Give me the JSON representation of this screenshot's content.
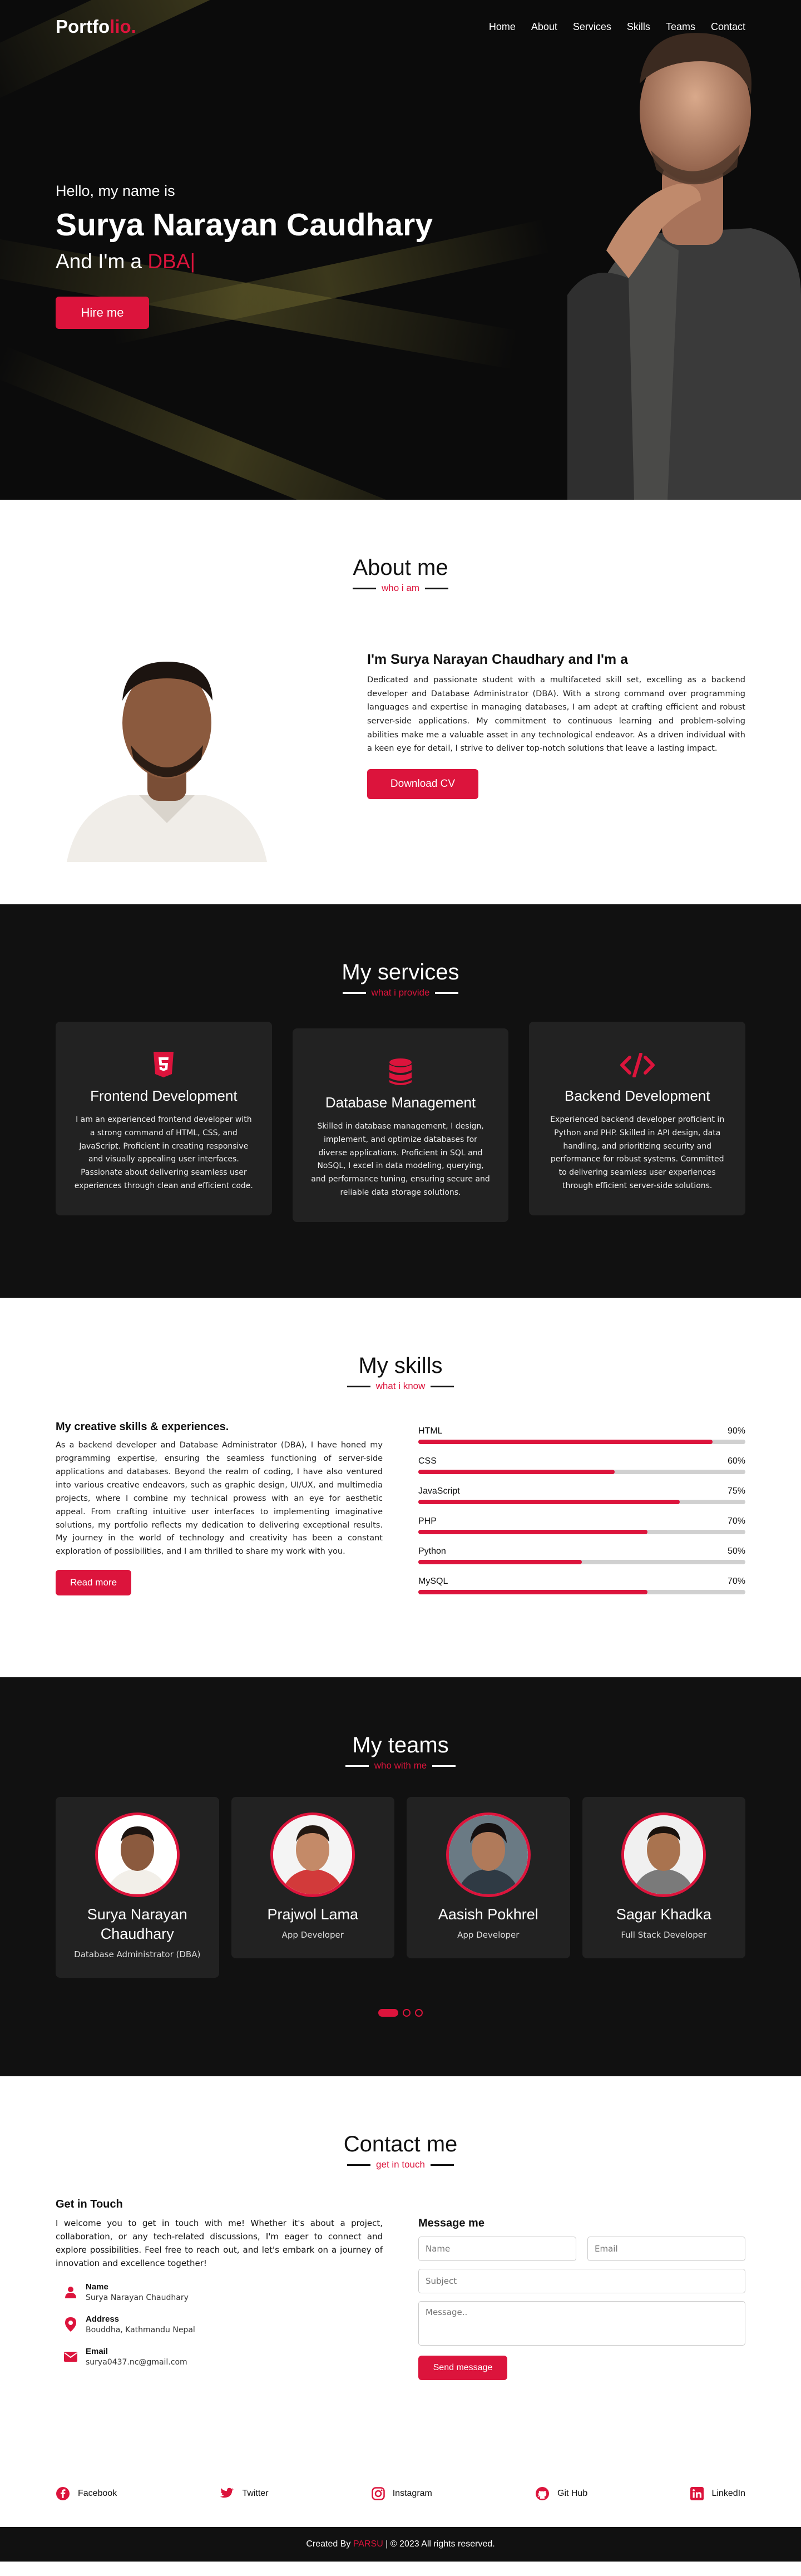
{
  "nav": {
    "logo_main": "Portfo",
    "logo_accent": "lio.",
    "items": [
      "Home",
      "About",
      "Services",
      "Skills",
      "Teams",
      "Contact"
    ]
  },
  "hero": {
    "hello": "Hello, my name is",
    "name": "Surya Narayan Caudhary",
    "role_prefix": "And I'm a",
    "role": "DBA",
    "caret": "|",
    "button": "Hire me"
  },
  "about": {
    "title": "About me",
    "subtitle": "who i am",
    "heading": "I'm Surya Narayan Chaudhary and I'm a",
    "text": "Dedicated and passionate student with a multifaceted skill set, excelling as a backend developer and Database Administrator (DBA). With a strong command over programming languages and expertise in managing databases, I am adept at crafting efficient and robust server-side applications. My commitment to continuous learning and problem-solving abilities make me a valuable asset in any technological endeavor. As a driven individual with a keen eye for detail, I strive to deliver top-notch solutions that leave a lasting impact.",
    "button": "Download CV"
  },
  "services": {
    "title": "My services",
    "subtitle": "what i provide",
    "items": [
      {
        "title": "Frontend Development",
        "icon": "html5-icon",
        "text": "I am an experienced frontend developer with a strong command of HTML, CSS, and JavaScript. Proficient in creating responsive and visually appealing user interfaces. Passionate about delivering seamless user experiences through clean and efficient code."
      },
      {
        "title": "Database Management",
        "icon": "database-icon",
        "text": "Skilled in database management, I design, implement, and optimize databases for diverse applications. Proficient in SQL and NoSQL, I excel in data modeling, querying, and performance tuning, ensuring secure and reliable data storage solutions."
      },
      {
        "title": "Backend Development",
        "icon": "code-icon",
        "text": "Experienced backend developer proficient in Python and PHP. Skilled in API design, data handling, and prioritizing security and performance for robust systems. Committed to delivering seamless user experiences through efficient server-side solutions."
      }
    ]
  },
  "skills": {
    "title": "My skills",
    "subtitle": "what i know",
    "heading": "My creative skills & experiences.",
    "text": "As a backend developer and Database Administrator (DBA), I have honed my programming expertise, ensuring the seamless functioning of server-side applications and databases. Beyond the realm of coding, I have also ventured into various creative endeavors, such as graphic design, UI/UX, and multimedia projects, where I combine my technical prowess with an eye for aesthetic appeal. From crafting intuitive user interfaces to implementing imaginative solutions, my portfolio reflects my dedication to delivering exceptional results. My journey in the world of technology and creativity has been a constant exploration of possibilities, and I am thrilled to share my work with you.",
    "button": "Read more",
    "bars": [
      {
        "name": "HTML",
        "value": "90%",
        "pct": 90
      },
      {
        "name": "CSS",
        "value": "60%",
        "pct": 60
      },
      {
        "name": "JavaScript",
        "value": "75%",
        "pct": 80
      },
      {
        "name": "PHP",
        "value": "70%",
        "pct": 70
      },
      {
        "name": "Python",
        "value": "50%",
        "pct": 50
      },
      {
        "name": "MySQL",
        "value": "70%",
        "pct": 70
      }
    ]
  },
  "teams": {
    "title": "My teams",
    "subtitle": "who with me",
    "members": [
      {
        "name": "Surya Narayan Chaudhary",
        "role": "Database Administrator (DBA)"
      },
      {
        "name": "Prajwol Lama",
        "role": "App Developer"
      },
      {
        "name": "Aasish Pokhrel",
        "role": "App Developer"
      },
      {
        "name": "Sagar Khadka",
        "role": "Full Stack Developer"
      }
    ]
  },
  "contact": {
    "title": "Contact me",
    "subtitle": "get in touch",
    "heading": "Get in Touch",
    "text": "I welcome you to get in touch with me! Whether it's about a project, collaboration, or any tech-related discussions, I'm eager to connect and explore possibilities. Feel free to reach out, and let's embark on a journey of innovation and excellence together!",
    "name_label": "Name",
    "name_value": "Surya Narayan Chaudhary",
    "address_label": "Address",
    "address_value": "Bouddha, Kathmandu Nepal",
    "email_label": "Email",
    "email_value": "surya0437.nc@gmail.com",
    "form_heading": "Message me",
    "ph_name": "Name",
    "ph_email": "Email",
    "ph_subject": "Subject",
    "ph_message": "Message..",
    "send": "Send message"
  },
  "social": [
    "Facebook",
    "Twitter",
    "Instagram",
    "Git Hub",
    "LinkedIn"
  ],
  "footer": {
    "prefix": "Created By",
    "author": "PARSU",
    "suffix": "| © 2023 All rights reserved."
  },
  "colors": {
    "accent": "#dc143c",
    "dark": "#111111",
    "card": "#222222"
  }
}
